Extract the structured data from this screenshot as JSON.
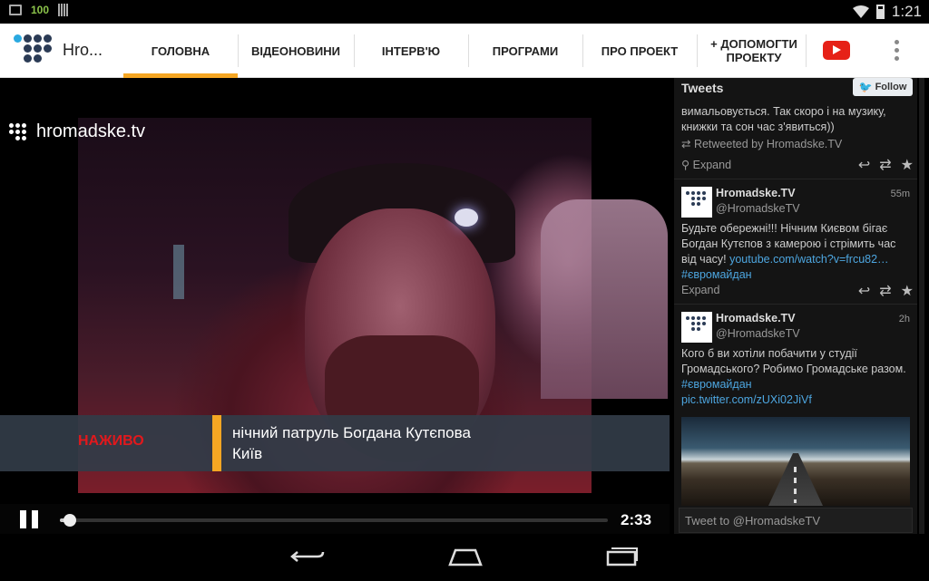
{
  "status_bar": {
    "battery_text": "100",
    "time": "1:21"
  },
  "app_bar": {
    "title": "Hro...",
    "nav": [
      {
        "label": "ГОЛОВНА",
        "active": true
      },
      {
        "label": "ВІДЕОНОВИНИ",
        "active": false
      },
      {
        "label": "ІНТЕРВ'Ю",
        "active": false
      },
      {
        "label": "ПРОГРАМИ",
        "active": false
      },
      {
        "label": "ПРО ПРОЕКТ",
        "active": false
      },
      {
        "label": "+ ДОПОМОГТИ\nПРОЕКТУ",
        "active": false
      }
    ],
    "youtube_icon": "youtube-icon",
    "overflow_icon": "more-vert-icon",
    "accent_color": "#f5a623"
  },
  "video": {
    "watermark": "hromadske.tv",
    "live_label": "НАЖИВО",
    "caption_line1": "нічний патруль Богдана Кутєпова",
    "caption_line2": "Київ",
    "time_label": "2:33",
    "progress": 0.01,
    "live_color": "#e2181c"
  },
  "tweets_panel": {
    "title": "Tweets",
    "follow_label": "Follow",
    "tweet0": {
      "text": "вимальовується. Так скоро і на музику, книжки та сон час з'явиться))",
      "retweeted": "Retweeted by Hromadske.TV",
      "expand": "Expand"
    },
    "tweet1": {
      "name": "Hromadske.TV",
      "handle": "@HromadskeTV",
      "time": "55m",
      "text": "Будьте обережні!!! Нічним Києвом бігає Богдан Кутєпов з камерою і стрімить час від часу!",
      "link": "youtube.com/watch?v=frcu82…",
      "hashtag": "#євромайдан",
      "expand": "Expand"
    },
    "tweet2": {
      "name": "Hromadske.TV",
      "handle": "@HromadskeTV",
      "time": "2h",
      "text": "Кого б ви хотіли побачити у студії Громадського?   Робимо Громадське разом.",
      "hashtag": "#євромайдан",
      "link": "pic.twitter.com/zUXi02JiVf"
    },
    "compose_placeholder": "Tweet to @HromadskeTV"
  }
}
